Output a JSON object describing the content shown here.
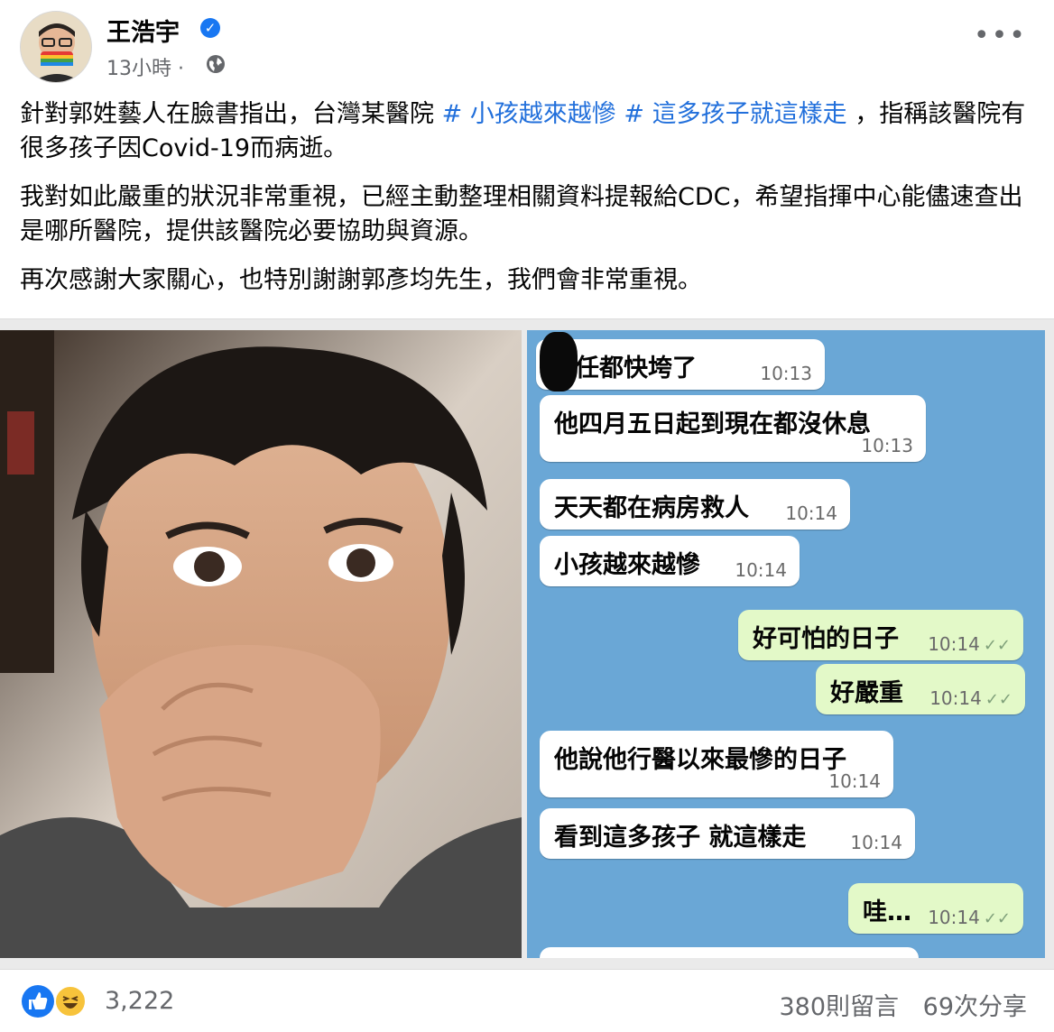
{
  "post": {
    "author": "王浩宇",
    "timestamp": "13小時",
    "privacy_icon": "globe-icon",
    "more_icon": "ellipsis-icon",
    "verified_icon": "verified-badge-icon",
    "paragraphs": {
      "p1_pre": "針對郭姓藝人在臉書指出，台灣某醫院 ",
      "tag1": "# 小孩越來越慘",
      "tag2": "# 這多孩子就這樣走",
      "p1_post": " ，指稱該醫院有很多孩子因Covid-19而病逝。",
      "p2": "我對如此嚴重的狀況非常重視，已經主動整理相關資料提報給CDC，希望指揮中心能儘速查出是哪所醫院，提供該醫院必要協助與資源。",
      "p3": "再次感謝大家關心，也特別謝謝郭彥均先生，我們會非常重視。"
    }
  },
  "chat": {
    "messages": [
      {
        "side": "in",
        "text": "主任都快垮了",
        "time": "10:13"
      },
      {
        "side": "in",
        "text": "他四月五日起到現在都沒休息",
        "time": "10:13"
      },
      {
        "side": "in",
        "text": "天天都在病房救人",
        "time": "10:14"
      },
      {
        "side": "in",
        "text": "小孩越來越慘",
        "time": "10:14"
      },
      {
        "side": "out",
        "text": "好可怕的日子",
        "time": "10:14"
      },
      {
        "side": "out",
        "text": "好嚴重",
        "time": "10:14"
      },
      {
        "side": "in",
        "text": "他說他行醫以來最慘的日子",
        "time": "10:14"
      },
      {
        "side": "in",
        "text": "看到這多孩子 就這樣走",
        "time": "10:14"
      },
      {
        "side": "out",
        "text": "哇…",
        "time": "10:14"
      }
    ]
  },
  "footer": {
    "reaction_icons": [
      "like-icon",
      "haha-icon"
    ],
    "reaction_count": "3,222",
    "comments": "380則留言",
    "shares": "69次分享"
  },
  "colors": {
    "accent": "#1877f2",
    "hashtag": "#216fdb",
    "chat_bg": "#6aa7d6",
    "bubble_out": "#e3f9c8"
  }
}
